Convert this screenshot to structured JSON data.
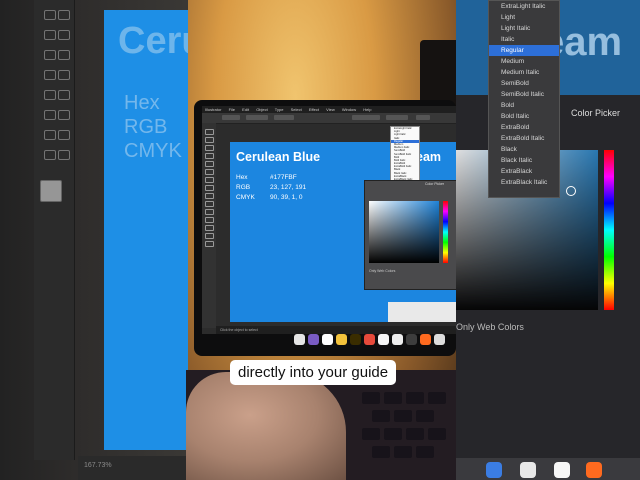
{
  "app": {
    "name": "Illustrator"
  },
  "menu": [
    "Illustrator",
    "File",
    "Edit",
    "Object",
    "Type",
    "Select",
    "Effect",
    "View",
    "Window",
    "Help"
  ],
  "document": {
    "title": "Cerulean Blue",
    "title_partial_right": "eam",
    "swatch_rows": [
      {
        "label": "Hex",
        "value": "#177FBF"
      },
      {
        "label": "RGB",
        "value": "23, 127, 191"
      },
      {
        "label": "CMYK",
        "value": "90, 39, 1, 0"
      }
    ]
  },
  "font_style_menu": {
    "items": [
      "ExtraLight Italic",
      "Light",
      "Light Italic",
      "Italic",
      "Regular",
      "Medium",
      "Medium Italic",
      "SemiBold",
      "SemiBold Italic",
      "Bold",
      "Bold Italic",
      "ExtraBold",
      "ExtraBold Italic",
      "Black",
      "Black Italic",
      "ExtraBlack",
      "ExtraBlack Italic"
    ],
    "selected": "Regular"
  },
  "color_picker": {
    "title": "Color Picker",
    "only_web_colors": "Only Web Colors"
  },
  "statusbar": {
    "zoom": "167.73%",
    "hint": "Click the object to select"
  },
  "caption": "directly into your guide",
  "colors": {
    "brand_blue": "#177FBF",
    "selection": "#2D6FD8"
  }
}
